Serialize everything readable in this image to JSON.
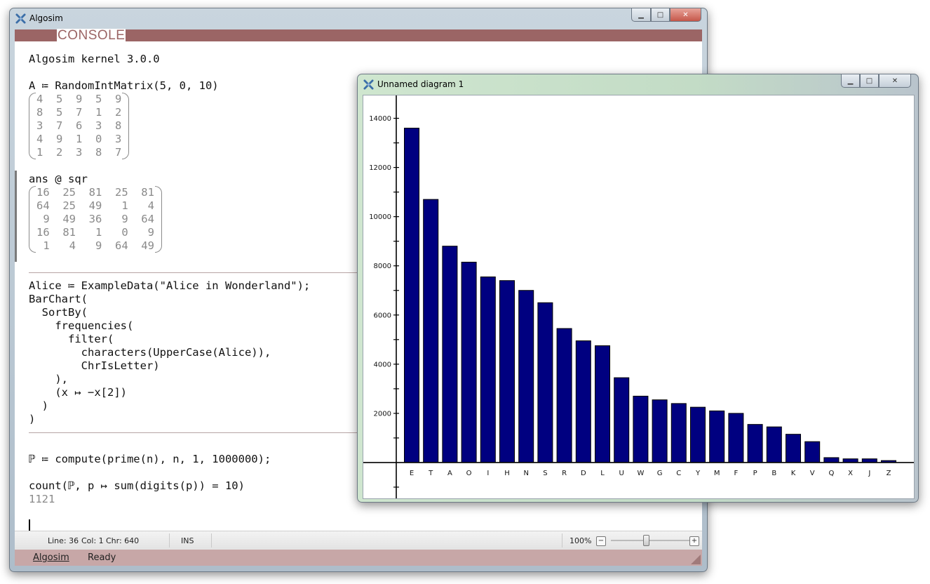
{
  "main_window": {
    "title": "Algosim",
    "tab_label": "CONSOLE",
    "caption": {
      "minimize": "▁",
      "maximize": "□",
      "close": "✕"
    }
  },
  "console": {
    "kernel_line": "Algosim kernel 3.0.0",
    "cmd_matrix": "A ≔ RandomIntMatrix(5, 0, 10)",
    "matrix_A": [
      "4  5  9  5  9",
      "8  5  7  1  2",
      "3  7  6  3  8",
      "4  9  1  0  3",
      "1  2  3  8  7"
    ],
    "cmd_sqr": "ans @ sqr",
    "matrix_sqr": [
      "16  25  81  25  81",
      "64  25  49   1   4",
      " 9  49  36   9  64",
      "16  81   1   0   9",
      " 1   4   9  64  49"
    ],
    "alice_code": [
      "Alice ≔ ExampleData(\"Alice in Wonderland\");",
      "BarChart(",
      "  SortBy(",
      "    frequencies(",
      "      filter(",
      "        characters(UpperCase(Alice)),",
      "        ChrIsLetter)",
      "    ),",
      "    (x ↦ −x[2])",
      "  )",
      ")"
    ],
    "cmd_primes": "ℙ ≔ compute(prime(n), n, 1, 1000000);",
    "cmd_count": "count(ℙ, p ↦ sum(digits(p)) = 10)",
    "count_result": "1121"
  },
  "statusbar": {
    "line": "Line: 36",
    "col": "Col: 1",
    "chr": "Chr: 640",
    "mode": "INS",
    "zoom": "100%",
    "zoom_minus": "−",
    "zoom_plus": "+",
    "zoom_level": 0.5
  },
  "bottomband": {
    "app_label": "Algosim",
    "status": "Ready"
  },
  "diagram_window": {
    "title": "Unnamed diagram 1",
    "caption": {
      "minimize": "▁",
      "maximize": "□",
      "close": "✕"
    }
  },
  "colors": {
    "bar": "#000080",
    "tab": "#9b6565",
    "bottom": "#c7a7a7"
  },
  "chart_data": {
    "type": "bar",
    "categories": [
      "E",
      "T",
      "A",
      "O",
      "I",
      "H",
      "N",
      "S",
      "R",
      "D",
      "L",
      "U",
      "W",
      "G",
      "C",
      "Y",
      "M",
      "F",
      "P",
      "B",
      "K",
      "V",
      "Q",
      "X",
      "J",
      "Z"
    ],
    "values": [
      13600,
      10700,
      8800,
      8150,
      7550,
      7400,
      7000,
      6500,
      5450,
      4950,
      4750,
      3450,
      2700,
      2550,
      2400,
      2250,
      2100,
      2000,
      1550,
      1450,
      1150,
      850,
      200,
      150,
      150,
      80
    ],
    "yticks": [
      "2000",
      "4000",
      "6000",
      "8000",
      "10000",
      "12000",
      "14000"
    ],
    "ylim": [
      -1400,
      14700
    ],
    "title": "",
    "xlabel": "",
    "ylabel": ""
  }
}
